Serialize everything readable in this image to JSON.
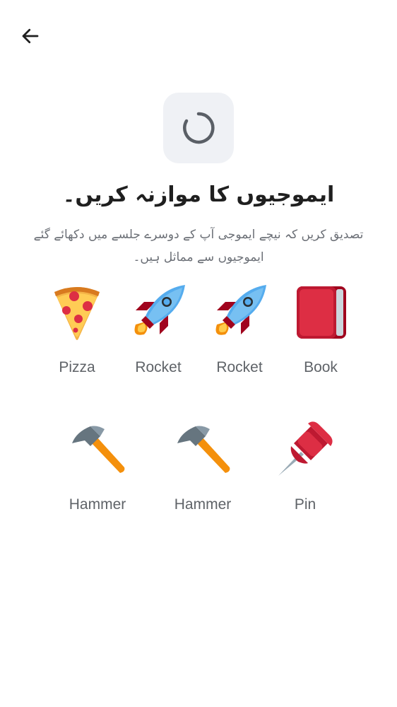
{
  "header": {
    "back_icon": "arrow-left-icon"
  },
  "status": {
    "icon": "loading-spinner-icon"
  },
  "title": "ایموجیوں کا موازنہ کریں۔",
  "subtitle": "تصدیق کریں کہ نیچے ایموجی آپ کے دوسرے جلسے میں دکھائے گئے ایموجیوں سے مماثل ہیں۔",
  "emojis": [
    {
      "icon": "pizza-icon",
      "label": "Pizza"
    },
    {
      "icon": "rocket-icon",
      "label": "Rocket"
    },
    {
      "icon": "rocket-icon",
      "label": "Rocket"
    },
    {
      "icon": "book-icon",
      "label": "Book"
    },
    {
      "icon": "hammer-icon",
      "label": "Hammer"
    },
    {
      "icon": "hammer-icon",
      "label": "Hammer"
    },
    {
      "icon": "pin-icon",
      "label": "Pin"
    }
  ],
  "colors": {
    "background": "#ffffff",
    "spinner_box": "#eff1f5",
    "label_text": "#5f6368",
    "title_text": "#1f1f1f"
  }
}
